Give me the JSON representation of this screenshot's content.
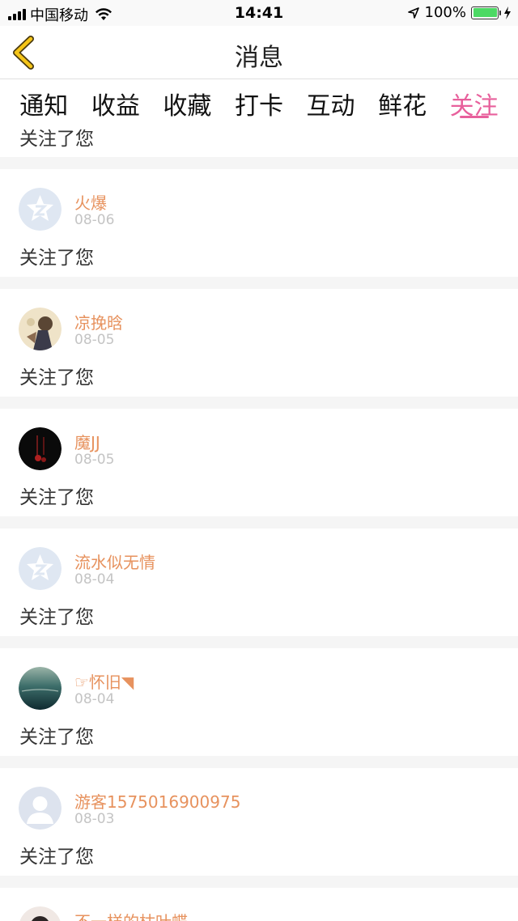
{
  "status_bar": {
    "carrier": "中国移动",
    "time": "14:41",
    "battery": "100%",
    "battery_level": 1.0
  },
  "nav": {
    "title": "消息",
    "back_icon": "chevron-left-icon",
    "accent": "#f5c518"
  },
  "tabs": [
    {
      "label": "通知",
      "active": false
    },
    {
      "label": "收益",
      "active": false
    },
    {
      "label": "收藏",
      "active": false
    },
    {
      "label": "打卡",
      "active": false
    },
    {
      "label": "互动",
      "active": false
    },
    {
      "label": "鲜花",
      "active": false
    },
    {
      "label": "关注",
      "active": true
    }
  ],
  "colors": {
    "active_tab": "#e8609c",
    "username": "#e7925e",
    "date": "#c4c4c4"
  },
  "partial_top": {
    "message": "关注了您"
  },
  "items": [
    {
      "name": "火爆",
      "date": "08-06",
      "message": "关注了您",
      "avatar": "qzone-default"
    },
    {
      "name": "凉挽晗",
      "date": "08-05",
      "message": "关注了您",
      "avatar": "photo-girl"
    },
    {
      "name": "魔JJ",
      "date": "08-05",
      "message": "关注了您",
      "avatar": "dark-photo"
    },
    {
      "name": "流水似无情",
      "date": "08-04",
      "message": "关注了您",
      "avatar": "qzone-default"
    },
    {
      "name": "☞怀旧◥",
      "date": "08-04",
      "message": "关注了您",
      "avatar": "ocean-photo"
    },
    {
      "name": "游客1575016900975",
      "date": "08-03",
      "message": "关注了您",
      "avatar": "default-person"
    }
  ],
  "partial_bottom": {
    "name": "不一样的枯叶蝶",
    "avatar": "photo-face"
  }
}
